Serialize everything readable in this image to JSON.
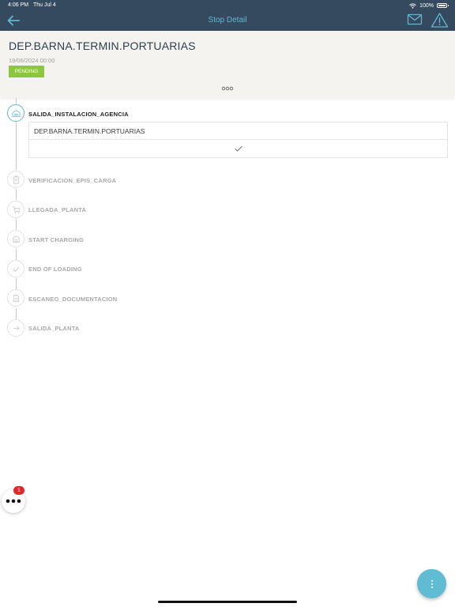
{
  "status_bar": {
    "time": "4:06 PM",
    "date": "Thu Jul 4",
    "battery": "100%"
  },
  "nav": {
    "title": "Stop Detail",
    "icons": [
      "back-arrow-icon",
      "mail-icon",
      "warning-icon"
    ]
  },
  "stop": {
    "name": "DEP.BARNA.TERMIN.PORTUARIAS",
    "datetime": "19/06/2024 00:00",
    "status": "PENDING"
  },
  "steps": [
    {
      "label": "SALIDA_INSTALACION_AGENCIA",
      "icon": "warehouse-icon",
      "active": true
    },
    {
      "label": "VERIFICACION_EPIS_CARGA",
      "icon": "clipboard-icon",
      "active": false
    },
    {
      "label": "LLEGADA_PLANTA",
      "icon": "cart-icon",
      "active": false
    },
    {
      "label": "START CHARGING",
      "icon": "loading-dock-icon",
      "active": false
    },
    {
      "label": "END OF LOADING",
      "icon": "check-icon",
      "active": false
    },
    {
      "label": "ESCANEO_DOCUMENTACION",
      "icon": "document-icon",
      "active": false
    },
    {
      "label": "SALIDA_PLANTA",
      "icon": "arrow-right-icon",
      "active": false
    }
  ],
  "active_detail": {
    "location": "DEP.BARNA.TERMIN.PORTUARIAS"
  },
  "floating": {
    "notification_count": "1"
  },
  "colors": {
    "nav_bg": "#354a5f",
    "accent": "#5fb8d0",
    "pending": "#8dc63f",
    "badge": "#e3262d"
  }
}
